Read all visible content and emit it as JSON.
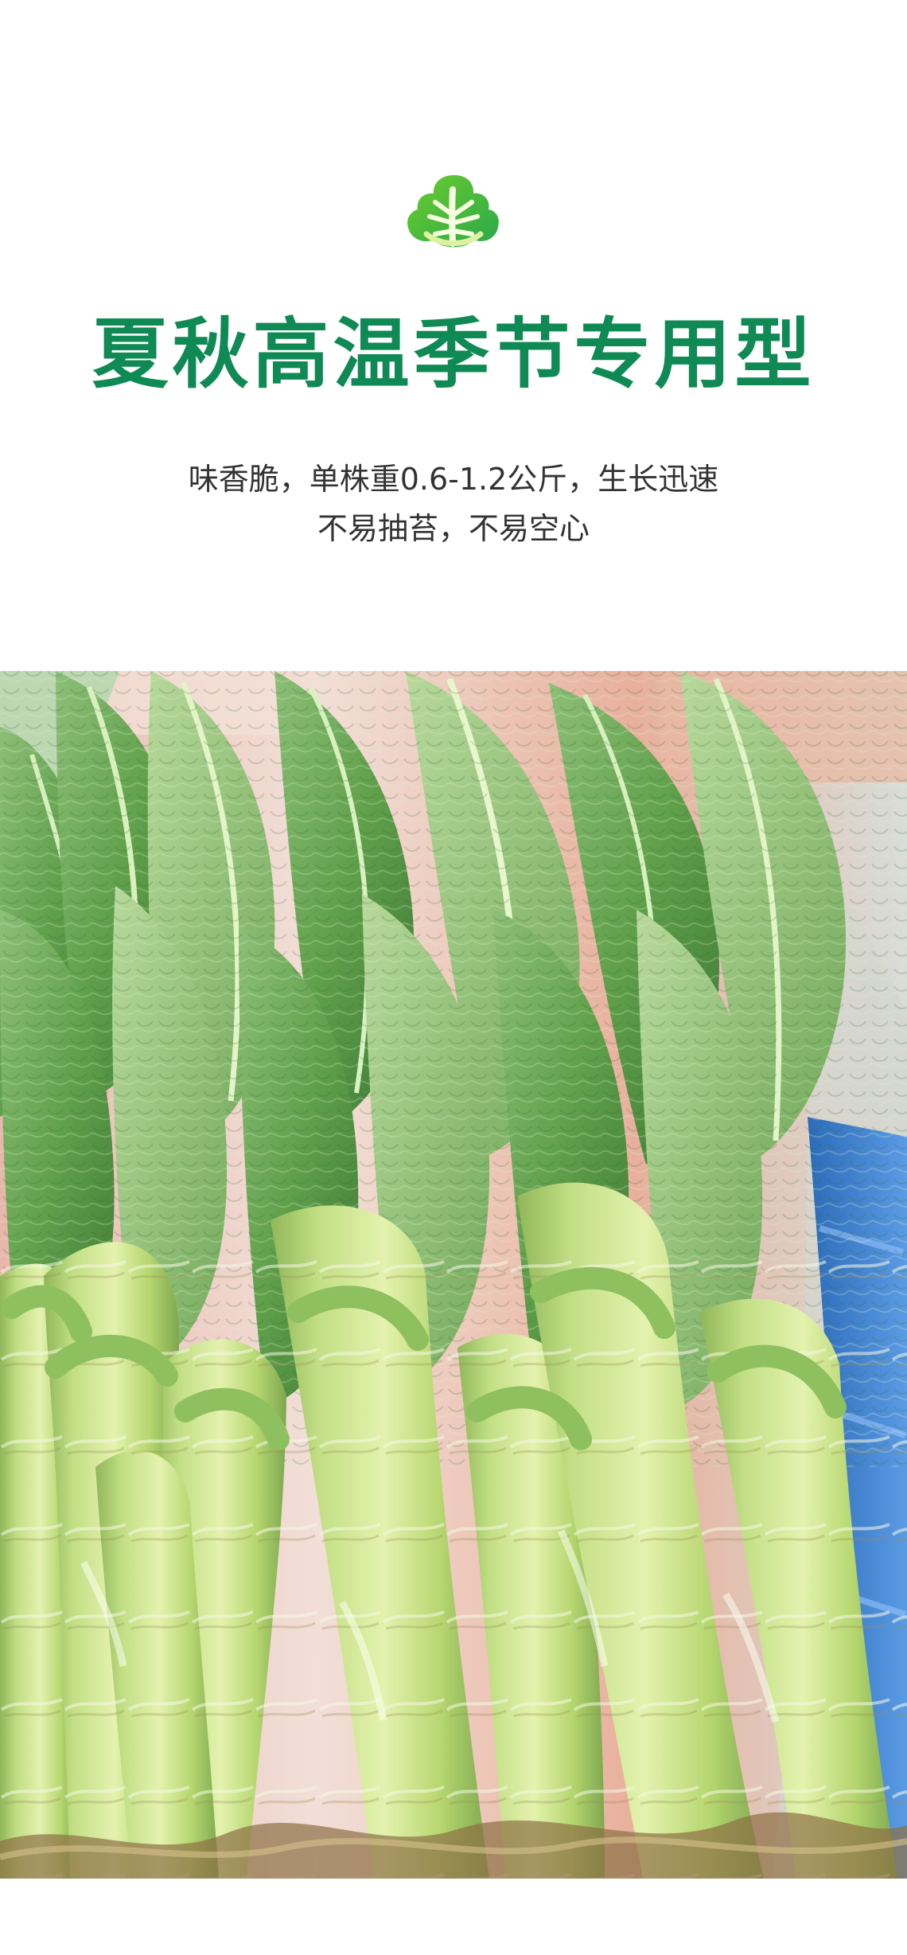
{
  "header": {
    "logo_icon": "lettuce-icon",
    "title": "夏秋高温季节专用型",
    "subtitle_line1": "味香脆，单株重0.6-1.2公斤，生长迅速",
    "subtitle_line2": "不易抽苔，不易空心"
  },
  "colors": {
    "title_green": "#0f8a55",
    "subtitle_text": "#333333",
    "stem_green": "#b7d67a",
    "leaf_green": "#5f9f4a",
    "crate_blue": "#3d7ecf"
  },
  "photo": {
    "subject": "lettuce-stems-photo"
  }
}
